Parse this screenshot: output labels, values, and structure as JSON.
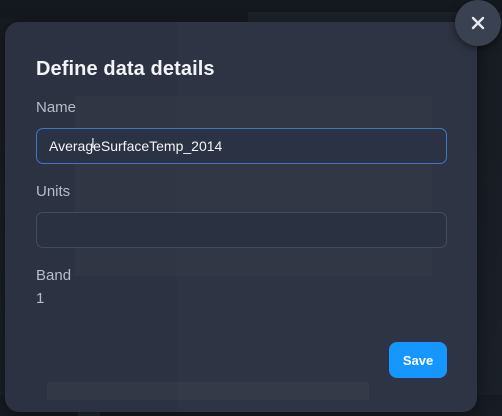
{
  "modal": {
    "title": "Define data details",
    "close_icon": "close-icon",
    "fields": {
      "name": {
        "label": "Name",
        "value": "AverageSurfaceTemp_2014"
      },
      "units": {
        "label": "Units",
        "value": ""
      },
      "band": {
        "label": "Band",
        "value": "1"
      }
    },
    "save_label": "Save"
  },
  "colors": {
    "accent": "#1697ff",
    "modal_bg": "#2c3241",
    "focus_border": "#3d78c8"
  }
}
